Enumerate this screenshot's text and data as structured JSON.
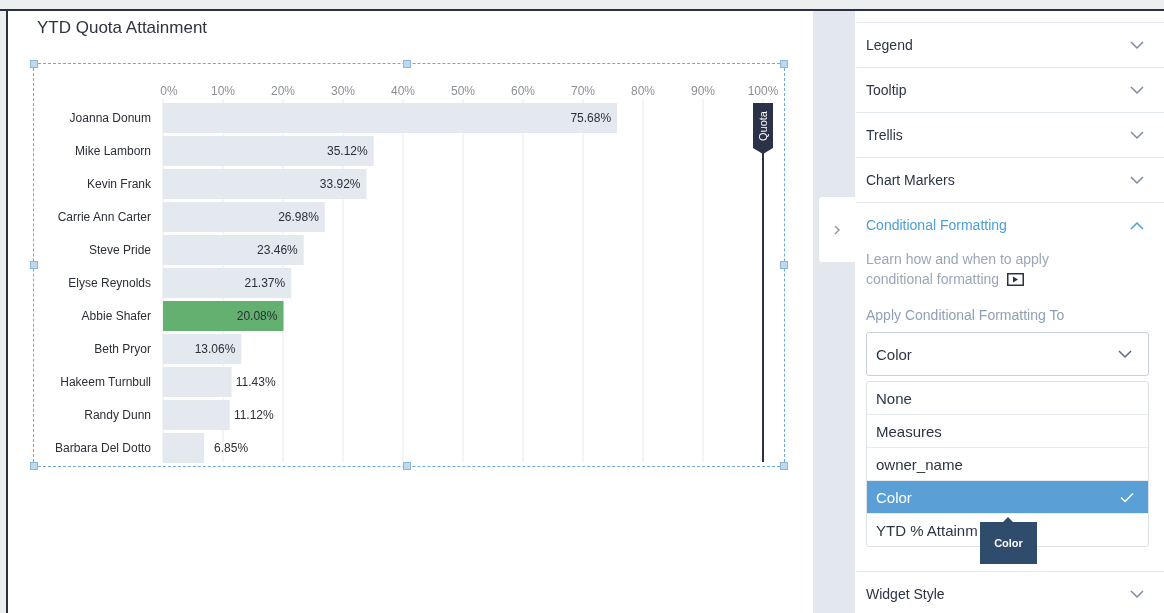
{
  "widget": {
    "title": "YTD Quota Attainment",
    "chart_data": {
      "type": "bar",
      "orientation": "horizontal",
      "categories": [
        "Joanna Donum",
        "Mike Lamborn",
        "Kevin Frank",
        "Carrie Ann Carter",
        "Steve Pride",
        "Elyse Reynolds",
        "Abbie Shafer",
        "Beth Pryor",
        "Hakeem Turnbull",
        "Randy Dunn",
        "Barbara Del Dotto"
      ],
      "series": [
        {
          "color": "#e4e8ef",
          "values": [
            75.68,
            35.12,
            33.92,
            26.98,
            23.46,
            21.37,
            null,
            13.06,
            11.43,
            11.12,
            6.85
          ]
        },
        {
          "color": "#63b070",
          "values": [
            null,
            null,
            null,
            null,
            null,
            null,
            20.08,
            null,
            null,
            null,
            null
          ]
        }
      ],
      "grid": true,
      "value_labels": [
        "75.68%",
        "35.12%",
        "33.92%",
        "26.98%",
        "23.46%",
        "21.37%",
        "20.08%",
        "13.06%",
        "11.43%",
        "11.12%",
        "6.85%"
      ],
      "xlim": [
        0,
        100
      ],
      "xticks": [
        {
          "value": 0,
          "label": "0%"
        },
        {
          "value": 10,
          "label": "10%"
        },
        {
          "value": 20,
          "label": "20%"
        },
        {
          "value": 30,
          "label": "30%"
        },
        {
          "value": 40,
          "label": "40%"
        },
        {
          "value": 50,
          "label": "50%"
        },
        {
          "value": 60,
          "label": "60%"
        },
        {
          "value": 70,
          "label": "70%"
        },
        {
          "value": 80,
          "label": "80%"
        },
        {
          "value": 90,
          "label": "90%"
        },
        {
          "value": 100,
          "label": "100%"
        }
      ],
      "ref_lines": [
        {
          "label": "Quota"
        }
      ]
    }
  },
  "panel": {
    "sections": [
      {
        "label": "Legend",
        "expanded": false
      },
      {
        "label": "Tooltip",
        "expanded": false
      },
      {
        "label": "Trellis",
        "expanded": false
      },
      {
        "label": "Chart Markers",
        "expanded": false
      },
      {
        "label": "Conditional Formatting",
        "expanded": true
      },
      {
        "label": "Widget Style",
        "expanded": false
      }
    ],
    "help_text": "Learn how and when to apply conditional formatting",
    "field_label": "Apply Conditional Formatting To",
    "select_value": "Color",
    "options": [
      {
        "label": "None",
        "selected": false
      },
      {
        "label": "Measures",
        "selected": false
      },
      {
        "label": "owner_name",
        "selected": false
      },
      {
        "label": "Color",
        "selected": true
      },
      {
        "label": "YTD % Attainm",
        "selected": false
      }
    ],
    "tooltip": "Color"
  }
}
